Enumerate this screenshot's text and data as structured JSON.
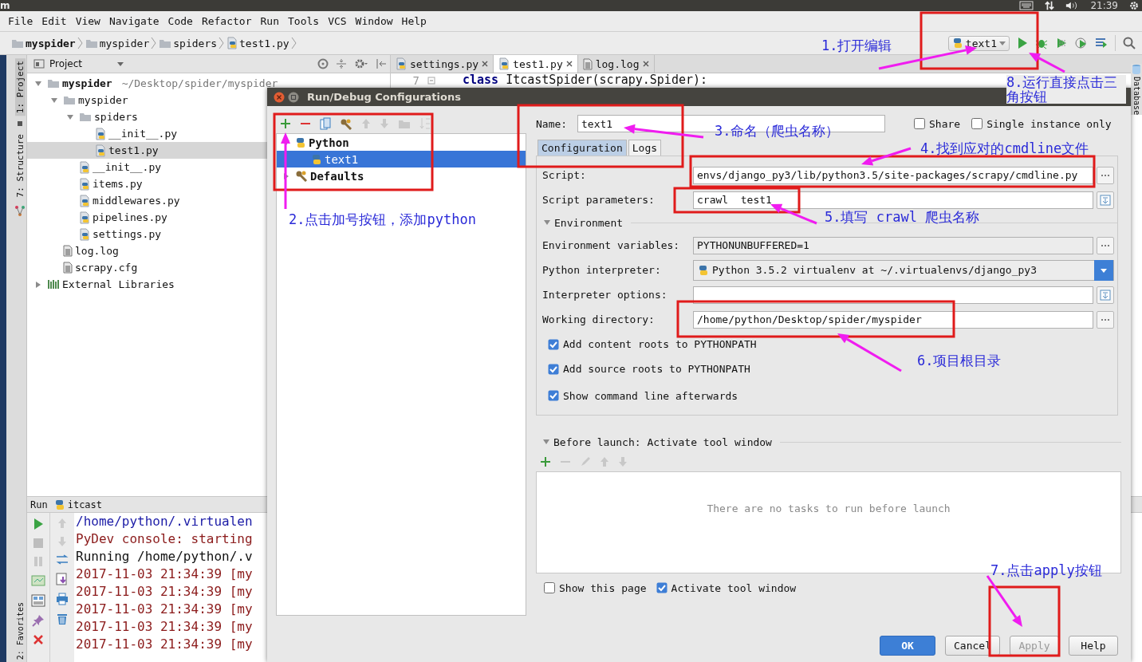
{
  "top_bar": {
    "app_letter": "m",
    "clock": "21:39"
  },
  "menu": [
    "File",
    "Edit",
    "View",
    "Navigate",
    "Code",
    "Refactor",
    "Run",
    "Tools",
    "VCS",
    "Window",
    "Help"
  ],
  "breadcrumbs": [
    {
      "label": "myspider",
      "kind": "project"
    },
    {
      "label": "myspider",
      "kind": "folder"
    },
    {
      "label": "spiders",
      "kind": "folder"
    },
    {
      "label": "test1.py",
      "kind": "pyfile"
    }
  ],
  "run_config": {
    "label": "text1"
  },
  "tool_windows": {
    "left": [
      {
        "label": "1: Project",
        "selected": true
      },
      {
        "label": "7: Structure",
        "selected": false
      }
    ],
    "bottom_left": {
      "label": "2: Favorites",
      "selected": false
    },
    "right": {
      "label": "Database",
      "selected": false
    }
  },
  "project_panel": {
    "title": "Project",
    "tree": [
      {
        "label": "myspider",
        "path": "~/Desktop/spider/myspider",
        "kind": "project",
        "expanded": true,
        "selected": false,
        "children": [
          {
            "label": "myspider",
            "kind": "folder",
            "expanded": true,
            "selected": false,
            "children": [
              {
                "label": "spiders",
                "kind": "folder",
                "expanded": true,
                "selected": false,
                "children": [
                  {
                    "label": "__init__.py",
                    "kind": "pyfile",
                    "selected": false
                  },
                  {
                    "label": "test1.py",
                    "kind": "pyfile",
                    "selected": true
                  }
                ]
              },
              {
                "label": "__init__.py",
                "kind": "pyfile",
                "selected": false
              },
              {
                "label": "items.py",
                "kind": "pyfile",
                "selected": false
              },
              {
                "label": "middlewares.py",
                "kind": "pyfile",
                "selected": false
              },
              {
                "label": "pipelines.py",
                "kind": "pyfile",
                "selected": false
              },
              {
                "label": "settings.py",
                "kind": "pyfile",
                "selected": false
              }
            ]
          },
          {
            "label": "log.log",
            "kind": "textfile",
            "selected": false
          },
          {
            "label": "scrapy.cfg",
            "kind": "textfile",
            "selected": false
          }
        ]
      },
      {
        "label": "External Libraries",
        "kind": "library",
        "expanded": false,
        "selected": false
      }
    ]
  },
  "editor": {
    "tabs": [
      {
        "label": "settings.py",
        "selected": false
      },
      {
        "label": "test1.py",
        "selected": true
      },
      {
        "label": "log.log",
        "selected": false
      }
    ],
    "lines": [
      {
        "number": "7",
        "code": "**class** ItcastSpider(scrapy.Spider):"
      }
    ]
  },
  "run_panel": {
    "title": "Run",
    "config": "itcast",
    "lines": [
      {
        "text": "/home/python/.virtualen",
        "kind": "command"
      },
      {
        "text": "PyDev console: starting",
        "kind": "stderr"
      },
      {
        "text": "Running /home/python/.v",
        "kind": "stdout"
      },
      {
        "text": "2017-11-03 21:34:39 [my",
        "kind": "stderr"
      },
      {
        "text": "2017-11-03 21:34:39 [my",
        "kind": "stderr"
      },
      {
        "text": "2017-11-03 21:34:39 [my",
        "kind": "stderr"
      },
      {
        "text": "2017-11-03 21:34:39 [my",
        "kind": "stderr"
      },
      {
        "text": "2017-11-03 21:34:39 [my",
        "kind": "stderr"
      }
    ]
  },
  "dialog": {
    "title": "Run/Debug Configurations",
    "tree": [
      {
        "label": "Python",
        "kind": "python-group",
        "expanded": true,
        "selected": false,
        "children": [
          {
            "label": "text1",
            "kind": "python-config",
            "selected": true
          }
        ]
      },
      {
        "label": "Defaults",
        "kind": "defaults",
        "expanded": false,
        "selected": false
      }
    ],
    "name": {
      "label": "Name:",
      "value": "text1"
    },
    "share": {
      "label": "Share",
      "checked": false
    },
    "single_instance": {
      "label": "Single instance only",
      "checked": false
    },
    "tabs": [
      {
        "label": "Configuration",
        "selected": true
      },
      {
        "label": "Logs",
        "selected": false
      }
    ],
    "fields": [
      {
        "kind": "browse",
        "label": "Script:",
        "value": "envs/django_py3/lib/python3.5/site-packages/scrapy/cmdline.py"
      },
      {
        "kind": "expand",
        "label": "Script parameters:",
        "value": "crawl  test1"
      },
      {
        "kind": "section",
        "label": "Environment",
        "expanded": true
      },
      {
        "kind": "readonly-browse",
        "label": "Environment variables:",
        "value": "PYTHONUNBUFFERED=1"
      },
      {
        "kind": "combo",
        "label": "Python interpreter:",
        "value": "Python 3.5.2 virtualenv at ~/.virtualenvs/django_py3"
      },
      {
        "kind": "expand",
        "label": "Interpreter options:"
      },
      {
        "kind": "browse",
        "label": "Working directory:",
        "value": "/home/python/Desktop/spider/myspider"
      }
    ],
    "options": [
      {
        "label": "Add content roots to PYTHONPATH",
        "checked": true
      },
      {
        "label": "Add source roots to PYTHONPATH",
        "checked": true
      },
      {
        "label": "Show command line afterwards",
        "checked": true
      }
    ],
    "before_launch": {
      "title": "Before launch: Activate tool window",
      "expanded": true,
      "empty_text": "There are no tasks to run before launch"
    },
    "bottom_options": [
      {
        "label": "Show this page",
        "checked": false
      },
      {
        "label": "Activate tool window",
        "checked": true
      }
    ],
    "buttons": [
      {
        "label": "OK",
        "default": true,
        "disabled": false
      },
      {
        "label": "Cancel",
        "default": false,
        "disabled": false
      },
      {
        "label": "Apply",
        "default": false,
        "disabled": true
      },
      {
        "label": "Help",
        "default": false,
        "disabled": false
      }
    ]
  },
  "annotations": [
    {
      "text": "1.打开编辑"
    },
    {
      "text": "8.运行直接点击三角按钮"
    },
    {
      "text": "3.命名（爬虫名称）"
    },
    {
      "text": "4.找到应对的cmdline文件"
    },
    {
      "text": "2.点击加号按钮，添加python"
    },
    {
      "text": "5.填写 crawl 爬虫名称"
    },
    {
      "text": "6.项目根目录"
    },
    {
      "text": "7.点击apply按钮"
    }
  ]
}
